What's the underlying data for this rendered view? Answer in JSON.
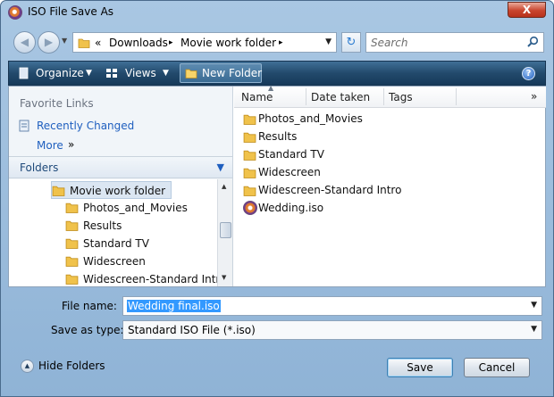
{
  "window": {
    "title": "ISO File Save As",
    "close_label": "X"
  },
  "navigation": {
    "breadcrumb": [
      "«",
      "Downloads",
      "▸",
      "Movie work folder",
      "▸"
    ],
    "search_placeholder": "Search"
  },
  "toolbar": {
    "organize": "Organize",
    "views": "Views",
    "new_folder": "New Folder",
    "help": "?"
  },
  "sidebar": {
    "favorite_links_heading": "Favorite Links",
    "recently_changed": "Recently Changed",
    "more": "More",
    "more_glyph": "»",
    "folders_label": "Folders",
    "tree": [
      {
        "label": "Movie work folder",
        "selected": true
      },
      {
        "label": "Photos_and_Movies"
      },
      {
        "label": "Results"
      },
      {
        "label": "Standard TV"
      },
      {
        "label": "Widescreen"
      },
      {
        "label": "Widescreen-Standard Intro"
      }
    ]
  },
  "file_list": {
    "columns": [
      "Name",
      "Date taken",
      "Tags"
    ],
    "overflow_glyph": "»",
    "items": [
      {
        "name": "Photos_and_Movies",
        "type": "folder"
      },
      {
        "name": "Results",
        "type": "folder"
      },
      {
        "name": "Standard TV",
        "type": "folder"
      },
      {
        "name": "Widescreen",
        "type": "folder"
      },
      {
        "name": "Widescreen-Standard Intro",
        "type": "folder"
      },
      {
        "name": "Wedding.iso",
        "type": "iso"
      }
    ]
  },
  "form": {
    "file_name_label": "File name:",
    "file_name_value": "Wedding final.iso",
    "save_as_type_label": "Save as type:",
    "save_as_type_value": "Standard ISO File (*.iso)"
  },
  "footer": {
    "hide_folders": "Hide Folders",
    "save": "Save",
    "cancel": "Cancel"
  },
  "colors": {
    "toolbar": "#234a6c",
    "link": "#1f5fbf",
    "selection": "#3399ff"
  }
}
